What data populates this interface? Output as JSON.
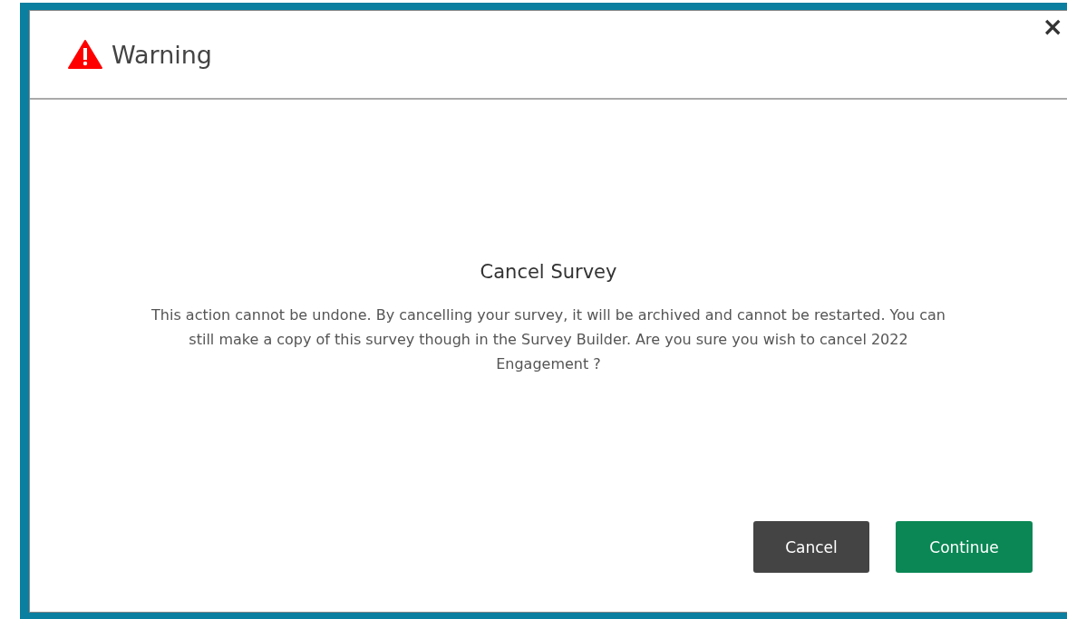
{
  "dialog": {
    "title": "Warning",
    "close": "×",
    "heading": "Cancel Survey",
    "message": "This action cannot be undone. By cancelling your survey, it will be archived and cannot be restarted. You can still make a copy of this survey though in the Survey Builder. Are you sure you wish to cancel 2022 Engagement ?",
    "buttons": [
      {
        "label": "Cancel",
        "kind": "secondary"
      },
      {
        "label": "Continue",
        "kind": "primary"
      }
    ]
  }
}
